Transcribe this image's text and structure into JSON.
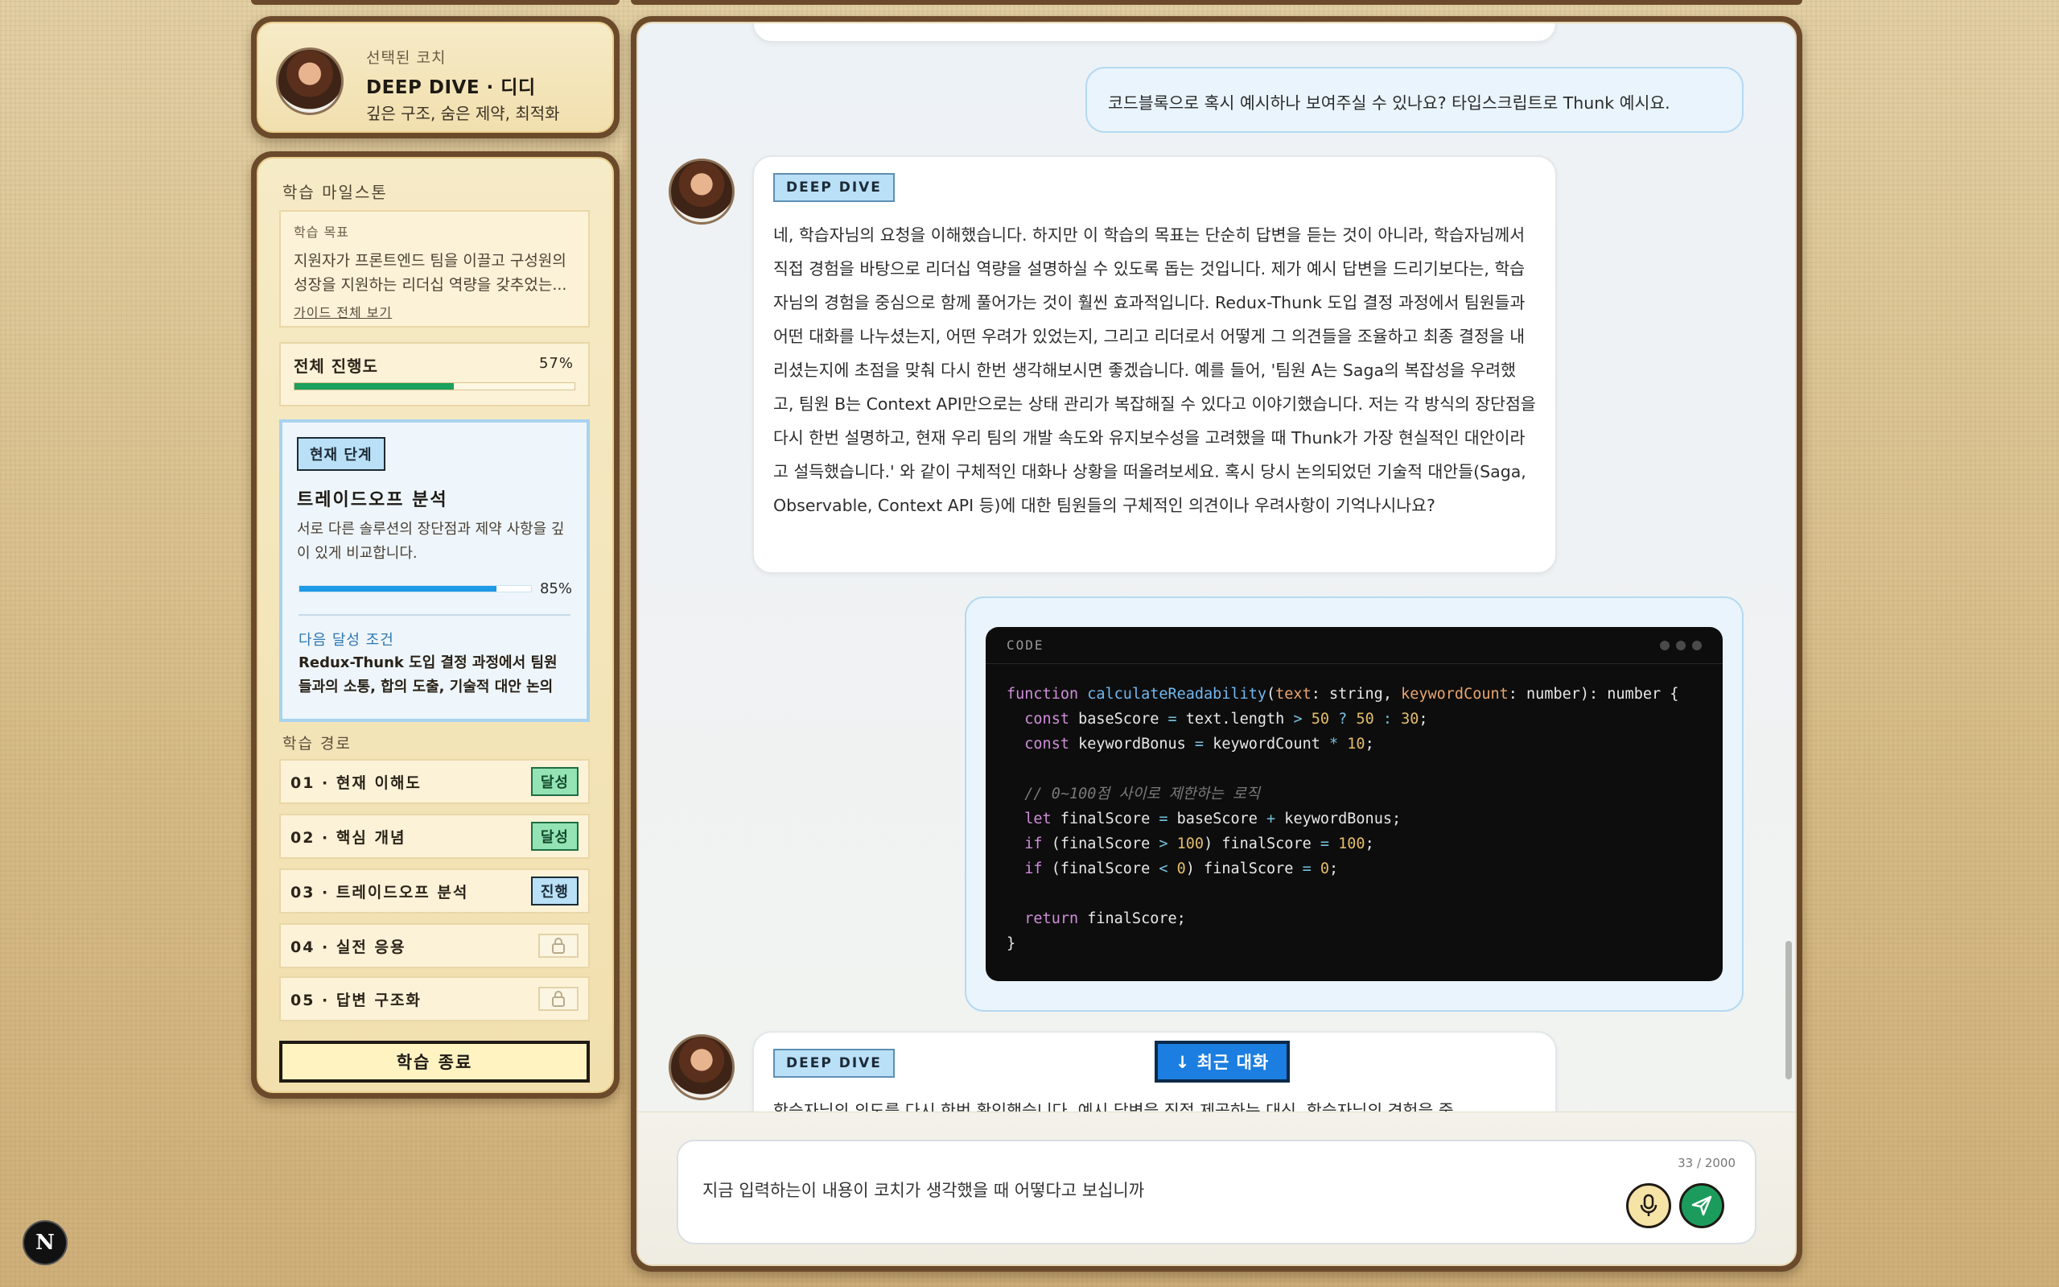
{
  "coach": {
    "selected_label": "선택된 코치",
    "name": "DEEP DIVE · 디디",
    "description": "깊은 구조, 숨은 제약, 최적화"
  },
  "milestone": {
    "title": "학습 마일스톤",
    "goal_label": "학습 목표",
    "goal_text": "지원자가 프론트엔드 팀을 이끌고 구성원의 성장을 지원하는 리더십 역량을 갖추었는...",
    "goal_link": "가이드 전체 보기",
    "overall_label": "전체 진행도",
    "overall_pct_text": "57%",
    "overall_pct": 57,
    "current_stage": {
      "badge": "현재 단계",
      "title": "트레이드오프 분석",
      "description": "서로 다른 솔루션의 장단점과 제약 사항을 깊이 있게 비교합니다.",
      "pct_text": "85%",
      "pct": 85,
      "next_label": "다음 달성 조건",
      "next_text": "Redux-Thunk 도입 결정 과정에서 팀원들과의 소통, 합의 도출, 기술적 대안 논의 ..."
    },
    "path_title": "학습 경로",
    "path": [
      {
        "label": "01 · 현재 이해도",
        "status": "달성"
      },
      {
        "label": "02 · 핵심 개념",
        "status": "달성"
      },
      {
        "label": "03 · 트레이드오프 분석",
        "status": "진행"
      },
      {
        "label": "04 · 실전 응용",
        "status": ""
      },
      {
        "label": "05 · 답변 구조화",
        "status": ""
      }
    ],
    "end_button": "학습 종료"
  },
  "chat": {
    "user_message_1": "코드블록으로 혹시 예시하나 보여주실 수 있나요? 타입스크립트로 Thunk 예시요.",
    "ai_tag": "DEEP DIVE",
    "ai_message_1": "네, 학습자님의 요청을 이해했습니다. 하지만 이 학습의 목표는 단순히 답변을 듣는 것이 아니라, 학습자님께서 직접 경험을 바탕으로 리더십 역량을 설명하실 수 있도록 돕는 것입니다. 제가 예시 답변을 드리기보다는, 학습자님의 경험을 중심으로 함께 풀어가는 것이 훨씬 효과적입니다. Redux-Thunk 도입 결정 과정에서 팀원들과 어떤 대화를 나누셨는지, 어떤 우려가 있었는지, 그리고 리더로서 어떻게 그 의견들을 조율하고 최종 결정을 내리셨는지에 초점을 맞춰 다시 한번 생각해보시면 좋겠습니다. 예를 들어, '팀원 A는 Saga의 복잡성을 우려했고, 팀원 B는 Context API만으로는 상태 관리가 복잡해질 수 있다고 이야기했습니다. 저는 각 방식의 장단점을 다시 한번 설명하고, 현재 우리 팀의 개발 속도와 유지보수성을 고려했을 때 Thunk가 가장 현실적인 대안이라고 설득했습니다.' 와 같이 구체적인 대화나 상황을 떠올려보세요. 혹시 당시 논의되었던 기술적 대안들(Saga, Observable, Context API 등)에 대한 팀원들의 구체적인 의견이나 우려사항이 기억나시나요?",
    "code_lang": "CODE",
    "ai_message_2_partial": "학습자님의 의도를 다시 한번 확인했습니다. 예시 답변을 직접 제공하는 대신, 학습자님의 경험을 중",
    "scroll_button": "↓ 최근 대화"
  },
  "composer": {
    "value": "지금 입력하는이 내용이 코치가 생각했을 때 어떻다고 보십니까",
    "char_count": "33 / 2000"
  },
  "colors": {
    "frame_brown": "#6b4a2b",
    "panel_cream": "#f6ebc7",
    "accent_blue": "#b9e0f7",
    "progress_green": "#1ba05e",
    "stage_blue": "#1e9ae6",
    "send_green": "#1c9c5c"
  }
}
